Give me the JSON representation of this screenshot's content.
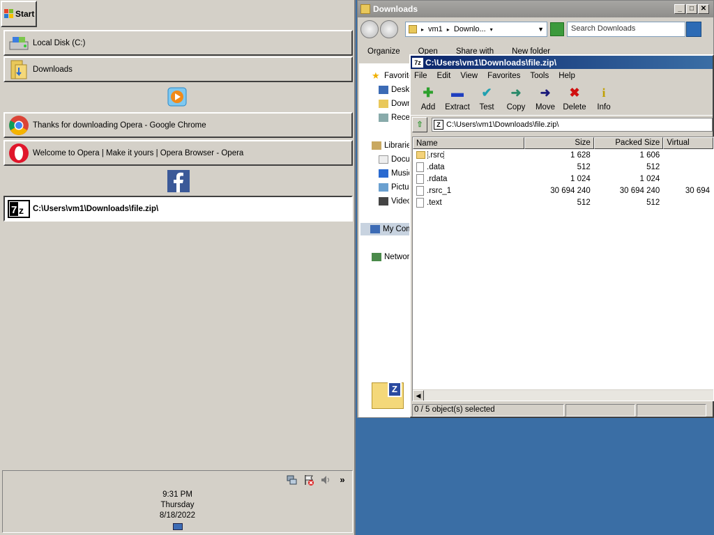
{
  "taskbar": {
    "start_label": "Start",
    "tasks": [
      {
        "label": "Local Disk (C:)",
        "icon": "drive-icon"
      },
      {
        "label": "Downloads",
        "icon": "folder-icon"
      },
      {
        "label": "Thanks for downloading Opera - Google Chrome",
        "icon": "chrome-icon"
      },
      {
        "label": "Welcome to Opera | Make it yours | Opera Browser - Opera",
        "icon": "opera-icon"
      },
      {
        "label": "C:\\Users\\vm1\\Downloads\\file.zip\\",
        "icon": "7zip-icon",
        "active": true
      }
    ],
    "quick_launch": [
      "media-player-icon",
      "facebook-icon"
    ],
    "tray_icons": [
      "network-icon",
      "action-center-icon",
      "volume-icon"
    ],
    "tray_expand": "»",
    "clock": {
      "time": "9:31 PM",
      "day": "Thursday",
      "date": "8/18/2022"
    }
  },
  "explorer": {
    "title": "Downloads",
    "address_parts": [
      "vm1",
      "Downlo..."
    ],
    "search_placeholder": "Search Downloads",
    "commands": [
      "Organize",
      "Open",
      "Share with",
      "New folder"
    ],
    "nav": [
      {
        "label": "Favorites",
        "icon": "star-icon"
      },
      {
        "label": "Desktop",
        "icon": "desktop-icon"
      },
      {
        "label": "Downloads",
        "icon": "folder-icon"
      },
      {
        "label": "Recent Places",
        "icon": "recent-icon"
      },
      {
        "label": "Libraries",
        "icon": "library-icon"
      },
      {
        "label": "Documents",
        "icon": "document-icon"
      },
      {
        "label": "Music",
        "icon": "music-icon"
      },
      {
        "label": "Pictures",
        "icon": "picture-icon"
      },
      {
        "label": "Videos",
        "icon": "video-icon"
      },
      {
        "label": "My Computer",
        "icon": "computer-icon"
      },
      {
        "label": "Network",
        "icon": "network-icon"
      }
    ]
  },
  "sevenzip": {
    "title": "C:\\Users\\vm1\\Downloads\\file.zip\\",
    "menu": [
      "File",
      "Edit",
      "View",
      "Favorites",
      "Tools",
      "Help"
    ],
    "toolbar": [
      {
        "label": "Add",
        "icon": "add-icon",
        "glyph": "✚",
        "color": "#2ca02c"
      },
      {
        "label": "Extract",
        "icon": "extract-icon",
        "glyph": "▬",
        "color": "#1f3fbf"
      },
      {
        "label": "Test",
        "icon": "test-icon",
        "glyph": "✔",
        "color": "#20a0b0"
      },
      {
        "label": "Copy",
        "icon": "copy-icon",
        "glyph": "➜",
        "color": "#2a8a6a"
      },
      {
        "label": "Move",
        "icon": "move-icon",
        "glyph": "➜",
        "color": "#1a1a7a"
      },
      {
        "label": "Delete",
        "icon": "delete-icon",
        "glyph": "✖",
        "color": "#d01010"
      },
      {
        "label": "Info",
        "icon": "info-icon",
        "glyph": "i",
        "color": "#c0a000"
      }
    ],
    "path": "C:\\Users\\vm1\\Downloads\\file.zip\\",
    "columns": {
      "name": "Name",
      "size": "Size",
      "packed": "Packed Size",
      "virtual": "Virtual"
    },
    "rows": [
      {
        "name": ".rsrc",
        "size": "1 628",
        "packed": "1 606",
        "virtual": "",
        "type": "folder"
      },
      {
        "name": ".data",
        "size": "512",
        "packed": "512",
        "virtual": "",
        "type": "file"
      },
      {
        "name": ".rdata",
        "size": "1 024",
        "packed": "1 024",
        "virtual": "",
        "type": "file"
      },
      {
        "name": ".rsrc_1",
        "size": "30 694 240",
        "packed": "30 694 240",
        "virtual": "30 694",
        "type": "file"
      },
      {
        "name": ".text",
        "size": "512",
        "packed": "512",
        "virtual": "",
        "type": "file"
      }
    ],
    "status": "0 / 5 object(s) selected"
  }
}
